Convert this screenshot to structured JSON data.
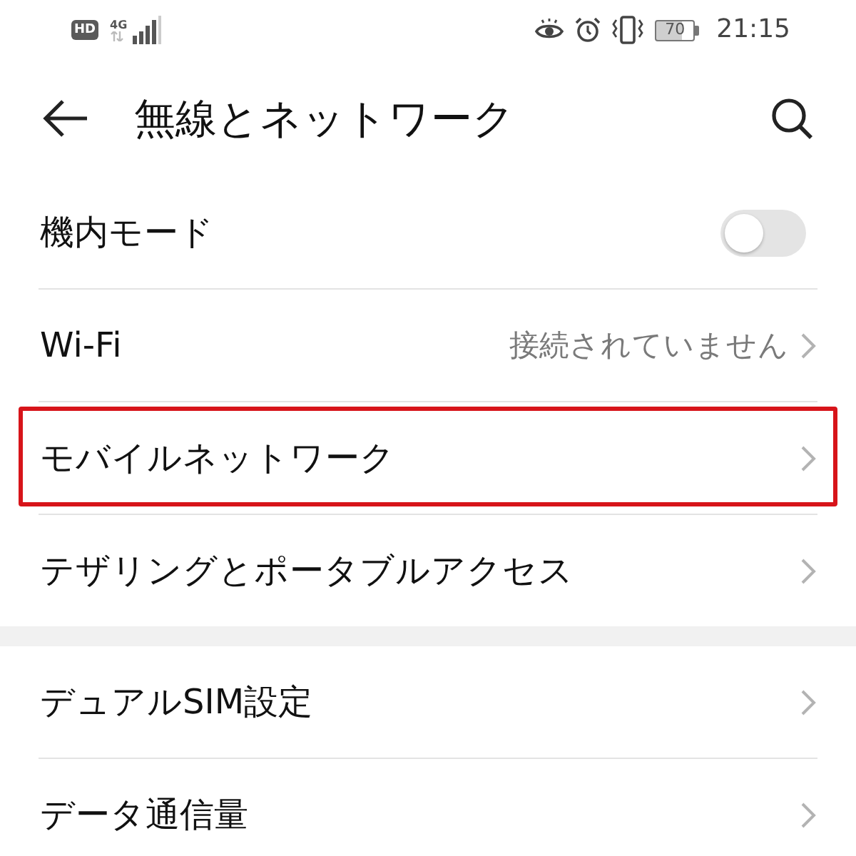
{
  "status_bar": {
    "hd_badge": "HD",
    "network_type": "4G",
    "battery_text": "70",
    "time": "21:15"
  },
  "header": {
    "title": "無線とネットワーク"
  },
  "sections": [
    {
      "items": [
        {
          "kind": "toggle",
          "label": "機内モード",
          "on": false,
          "highlighted": false
        },
        {
          "kind": "link",
          "label": "Wi-Fi",
          "value": "接続されていません",
          "highlighted": false
        },
        {
          "kind": "link",
          "label": "モバイルネットワーク",
          "highlighted": true
        },
        {
          "kind": "link",
          "label": "テザリングとポータブルアクセス",
          "highlighted": false
        }
      ]
    },
    {
      "items": [
        {
          "kind": "link",
          "label": "デュアルSIM設定",
          "highlighted": false
        },
        {
          "kind": "link",
          "label": "データ通信量",
          "highlighted": false
        }
      ]
    }
  ]
}
